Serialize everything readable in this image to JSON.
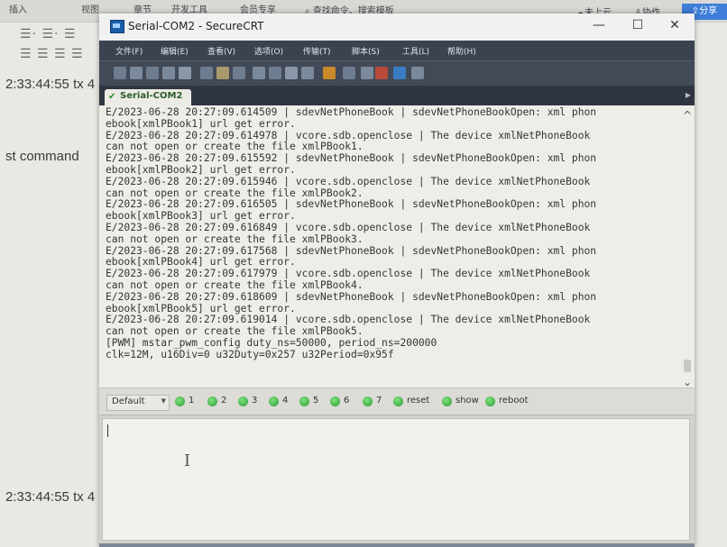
{
  "background_app": {
    "top_menu": [
      "插入",
      "视图",
      "章节",
      "开发工具",
      "会员专享"
    ],
    "search_text": "查找命令、搜索模板",
    "cloud_label": "未上云",
    "collab_label": "协作",
    "share_label": "分享",
    "list_row_1": "☰· ☰· ☰",
    "list_row_2": "☰ ☰ ☰ ☰",
    "text_line_1": "2:33:44:55 tx 4",
    "text_line_2": "st command",
    "text_line_3": "2:33:44:55 tx 4"
  },
  "window": {
    "title": "Serial-COM2 - SecureCRT",
    "minimize_glyph": "—",
    "maximize_glyph": "☐",
    "close_glyph": "✕"
  },
  "menu": [
    "文件(F)",
    "编辑(E)",
    "查看(V)",
    "选项(O)",
    "传输(T)",
    "脚本(S)",
    "工具(L)",
    "帮助(H)"
  ],
  "toolbar_icons": [
    {
      "name": "connect-icon",
      "color": "#6d7c8f"
    },
    {
      "name": "quick-connect-icon",
      "color": "#7a8a9c"
    },
    {
      "name": "connect-tab-icon",
      "color": "#6d7c8f"
    },
    {
      "name": "reconnect-icon",
      "color": "#7a8a9c"
    },
    {
      "name": "disconnect-icon",
      "color": "#8a97a8"
    },
    {
      "name": "copy-icon",
      "color": "#6d7c8f"
    },
    {
      "name": "paste-icon",
      "color": "#a89a6d"
    },
    {
      "name": "find-icon",
      "color": "#6d7c8f"
    },
    {
      "name": "print-icon",
      "color": "#7a8a9c"
    },
    {
      "name": "session-options-icon",
      "color": "#6d7c8f"
    },
    {
      "name": "global-options-icon",
      "color": "#8a97a8"
    },
    {
      "name": "key-map-icon",
      "color": "#7a8a9c"
    },
    {
      "name": "sftp-icon",
      "color": "#c98a2a"
    },
    {
      "name": "settings-icon",
      "color": "#6d7c8f"
    },
    {
      "name": "tools-icon",
      "color": "#7a8a9c"
    },
    {
      "name": "keygen-icon",
      "color": "#b84a3a"
    },
    {
      "name": "help-icon",
      "color": "#3a7cc4"
    },
    {
      "name": "about-icon",
      "color": "#7a8a9c"
    }
  ],
  "tab": {
    "label": "Serial-COM2"
  },
  "terminal": {
    "lines": [
      "E/2023-06-28 20:27:09.614509 | sdevNetPhoneBook | sdevNetPhoneBookOpen: xml phon",
      "ebook[xmlPBook1] url get error.",
      "E/2023-06-28 20:27:09.614978 | vcore.sdb.openclose | The device xmlNetPhoneBook",
      "can not open or create the file xmlPBook1.",
      "E/2023-06-28 20:27:09.615592 | sdevNetPhoneBook | sdevNetPhoneBookOpen: xml phon",
      "ebook[xmlPBook2] url get error.",
      "E/2023-06-28 20:27:09.615946 | vcore.sdb.openclose | The device xmlNetPhoneBook",
      "can not open or create the file xmlPBook2.",
      "E/2023-06-28 20:27:09.616505 | sdevNetPhoneBook | sdevNetPhoneBookOpen: xml phon",
      "ebook[xmlPBook3] url get error.",
      "E/2023-06-28 20:27:09.616849 | vcore.sdb.openclose | The device xmlNetPhoneBook",
      "can not open or create the file xmlPBook3.",
      "E/2023-06-28 20:27:09.617568 | sdevNetPhoneBook | sdevNetPhoneBookOpen: xml phon",
      "ebook[xmlPBook4] url get error.",
      "E/2023-06-28 20:27:09.617979 | vcore.sdb.openclose | The device xmlNetPhoneBook",
      "can not open or create the file xmlPBook4.",
      "E/2023-06-28 20:27:09.618609 | sdevNetPhoneBook | sdevNetPhoneBookOpen: xml phon",
      "ebook[xmlPBook5] url get error.",
      "E/2023-06-28 20:27:09.619014 | vcore.sdb.openclose | The device xmlNetPhoneBook",
      "can not open or create the file xmlPBook5.",
      "[PWM] mstar_pwm_config duty_ns=50000, period_ns=200000",
      "clk=12M, u16Div=0 u32Duty=0x257 u32Period=0x95f"
    ]
  },
  "button_bar": {
    "select_value": "Default",
    "buttons": [
      "1",
      "2",
      "3",
      "4",
      "5",
      "6",
      "7",
      "reset",
      "show",
      "reboot"
    ]
  }
}
